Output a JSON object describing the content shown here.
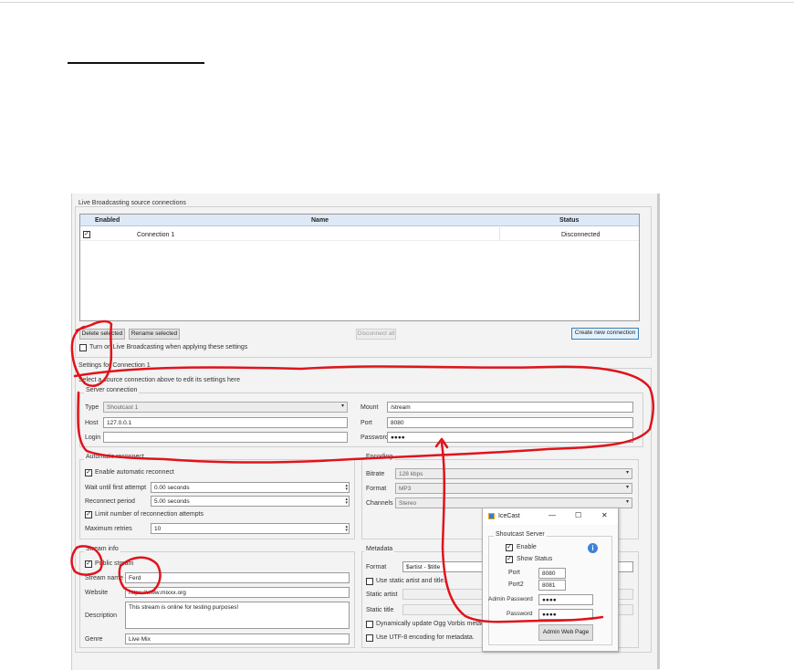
{
  "main_window": {
    "source_connections": {
      "title": "Live Broadcasting source connections",
      "columns": [
        "Enabled",
        "Name",
        "Status"
      ],
      "rows": [
        {
          "enabled": true,
          "name": "Connection 1",
          "status": "Disconnected"
        }
      ],
      "buttons": {
        "delete": "Delete selected",
        "rename": "Rename selected",
        "disconnect_all": "Disconnect all",
        "create": "Create new connection"
      },
      "turn_on_label": "Turn on Live Broadcasting when applying these settings",
      "turn_on_checked": false
    },
    "settings": {
      "title": "Settings for Connection 1",
      "hint": "Select a source connection above to edit its settings here",
      "server_connection": {
        "title": "Server connection",
        "type_label": "Type",
        "type_value": "Shoutcast 1",
        "host_label": "Host",
        "host_value": "127.0.0.1",
        "login_label": "Login",
        "login_value": "",
        "mount_label": "Mount",
        "mount_value": "/stream",
        "port_label": "Port",
        "port_value": "8080",
        "password_label": "Password",
        "password_value": "●●●●"
      },
      "automatic_reconnect": {
        "title": "Automatic reconnect",
        "enable_label": "Enable automatic reconnect",
        "enable_checked": true,
        "wait_label": "Wait until first attempt",
        "wait_value": "0.00 seconds",
        "period_label": "Reconnect period",
        "period_value": "5.00 seconds",
        "limit_label": "Limit number of reconnection attempts",
        "limit_checked": true,
        "max_label": "Maximum retries",
        "max_value": "10"
      },
      "encoding": {
        "title": "Encoding",
        "bitrate_label": "Bitrate",
        "bitrate_value": "128 kbps",
        "format_label": "Format",
        "format_value": "MP3",
        "channels_label": "Channels",
        "channels_value": "Stereo"
      },
      "stream_info": {
        "title": "Stream info",
        "public_label": "Public stream",
        "public_checked": true,
        "name_label": "Stream name",
        "name_value": "Ferd",
        "website_label": "Website",
        "website_value": "https://www.mixxx.org",
        "description_label": "Description",
        "description_value": "This stream is online for testing purposes!",
        "genre_label": "Genre",
        "genre_value": "Live Mix"
      },
      "metadata": {
        "title": "Metadata",
        "format_label": "Format",
        "format_value": "$artist - $title",
        "static_label": "Use static artist and title.",
        "static_artist_label": "Static artist",
        "static_title_label": "Static title",
        "ogg_label": "Dynamically update Ogg Vorbis metadata.",
        "utf8_label": "Use UTF-8 encoding for metadata."
      }
    }
  },
  "icecast_dialog": {
    "title": "IceCast",
    "window_controls": [
      "—",
      "☐",
      "✕"
    ],
    "group_title": "Shoutcast Server",
    "enable_label": "Enable",
    "enable_checked": true,
    "show_status_label": "Show Status",
    "show_status_checked": true,
    "port_label": "Port",
    "port_value": "8080",
    "port2_label": "Port2",
    "port2_value": "8081",
    "admin_password_label": "Admin Password",
    "admin_password_value": "●●●●",
    "password_label": "Password",
    "password_value": "●●●●",
    "admin_button": "Admin Web Page"
  },
  "colors": {
    "annotation_red": "#e0131b",
    "header_blue": "#dde9f7",
    "window_bg": "#f3f3f3"
  }
}
